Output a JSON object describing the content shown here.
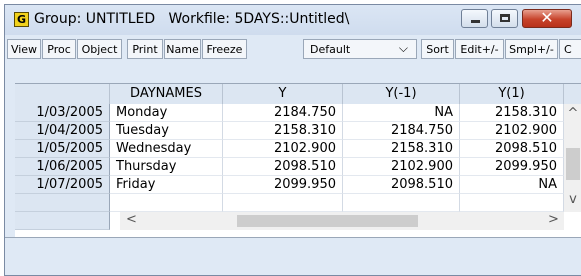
{
  "window": {
    "icon_letter": "G",
    "title": "Group: UNTITLED   Workfile: 5DAYS::Untitled\\",
    "close_glyph": "✕"
  },
  "toolbar": {
    "buttons": [
      "View",
      "Proc",
      "Object",
      "Print",
      "Name",
      "Freeze",
      "Sort",
      "Edit+/-",
      "Smpl+/-",
      "C"
    ],
    "display_select": "Default"
  },
  "table": {
    "columns": [
      "DAYNAMES",
      "Y",
      "Y(-1)",
      "Y(1)"
    ],
    "rows": [
      {
        "obs": "1/03/2005",
        "daynames": "Monday",
        "y": "2184.750",
        "y_lag": "NA",
        "y_lead": "2158.310"
      },
      {
        "obs": "1/04/2005",
        "daynames": "Tuesday",
        "y": "2158.310",
        "y_lag": "2184.750",
        "y_lead": "2102.900"
      },
      {
        "obs": "1/05/2005",
        "daynames": "Wednesday",
        "y": "2102.900",
        "y_lag": "2158.310",
        "y_lead": "2098.510"
      },
      {
        "obs": "1/06/2005",
        "daynames": "Thursday",
        "y": "2098.510",
        "y_lag": "2102.900",
        "y_lead": "2099.950"
      },
      {
        "obs": "1/07/2005",
        "daynames": "Friday",
        "y": "2099.950",
        "y_lag": "2098.510",
        "y_lead": "NA"
      }
    ]
  },
  "scroll": {
    "up": "^",
    "down": "v",
    "left": "<",
    "right": ">"
  }
}
